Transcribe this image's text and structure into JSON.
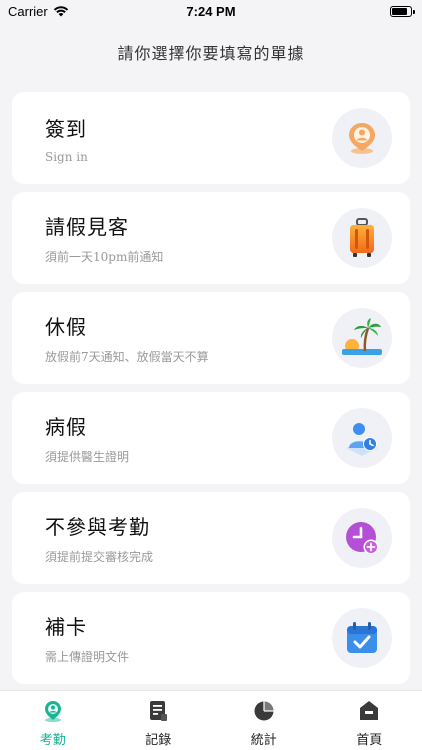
{
  "status_bar": {
    "carrier": "Carrier",
    "time": "7:24 PM",
    "battery_level": 0.85
  },
  "page": {
    "title": "請你選擇你要填寫的單據"
  },
  "cards": [
    {
      "title": "簽到",
      "subtitle": "Sign in",
      "icon": "location-pin-icon"
    },
    {
      "title": "請假見客",
      "subtitle": "須前一天10pm前通知",
      "icon": "suitcase-icon"
    },
    {
      "title": "休假",
      "subtitle": "放假前7天通知、放假當天不算",
      "icon": "beach-palm-icon"
    },
    {
      "title": "病假",
      "subtitle": "須提供醫生證明",
      "icon": "user-clock-icon"
    },
    {
      "title": "不參與考勤",
      "subtitle": "須提前提交審核完成",
      "icon": "clock-plus-icon"
    },
    {
      "title": "補卡",
      "subtitle": "需上傳證明文件",
      "icon": "calendar-check-icon"
    }
  ],
  "tabs": [
    {
      "label": "考勤",
      "icon": "location-pin-icon",
      "active": true
    },
    {
      "label": "記錄",
      "icon": "document-icon",
      "active": false
    },
    {
      "label": "統計",
      "icon": "pie-chart-icon",
      "active": false
    },
    {
      "label": "首頁",
      "icon": "home-icon",
      "active": false
    }
  ],
  "colors": {
    "accent": "#1ab394",
    "background": "#f4f4f6",
    "icon_circle": "#f0f1f6"
  }
}
